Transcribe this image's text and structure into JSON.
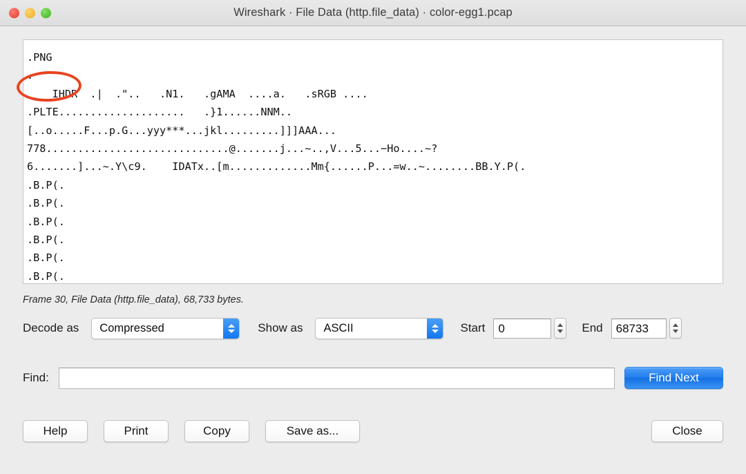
{
  "window": {
    "title": "Wireshark · File Data (http.file_data) · color-egg1.pcap",
    "traffic_lights": {
      "close": "close-button-red",
      "minimize": "minimize-button-yellow",
      "maximize": "maximize-button-green"
    }
  },
  "dump": {
    "lines": [
      ".PNG",
      ".",
      "    IHDR  .|  .\"..   .N1.   .gAMA  ....a.   .sRGB ....",
      ".PLTE....................   .}1......NNM..",
      "[..o.....F...p.G...yyy***...jkl.........]]]AAA...",
      "778.............................@.......j...~..,V...5...−Ho....~?",
      "6.......]...~.Y\\c9.    IDATx..[m.............Mm{......P...=w..~........BB.Y.P(.",
      ".B.P(.",
      ".B.P(.",
      ".B.P(.",
      ".B.P(.",
      ".B.P(.",
      ".B.P(."
    ],
    "annotation": {
      "shape": "ellipse",
      "target_text": ".PNG",
      "color": "#e8431f"
    }
  },
  "frame_info": "Frame 30, File Data (http.file_data), 68,733 bytes.",
  "controls": {
    "decode_as_label": "Decode as",
    "decode_as_value": "Compressed",
    "show_as_label": "Show as",
    "show_as_value": "ASCII",
    "start_label": "Start",
    "start_value": "0",
    "end_label": "End",
    "end_value": "68733"
  },
  "find": {
    "label": "Find:",
    "value": "",
    "placeholder": "",
    "button_label": "Find Next",
    "button_color": "#1f7bec"
  },
  "buttons": {
    "help": "Help",
    "print": "Print",
    "copy": "Copy",
    "save_as": "Save as...",
    "close": "Close"
  }
}
